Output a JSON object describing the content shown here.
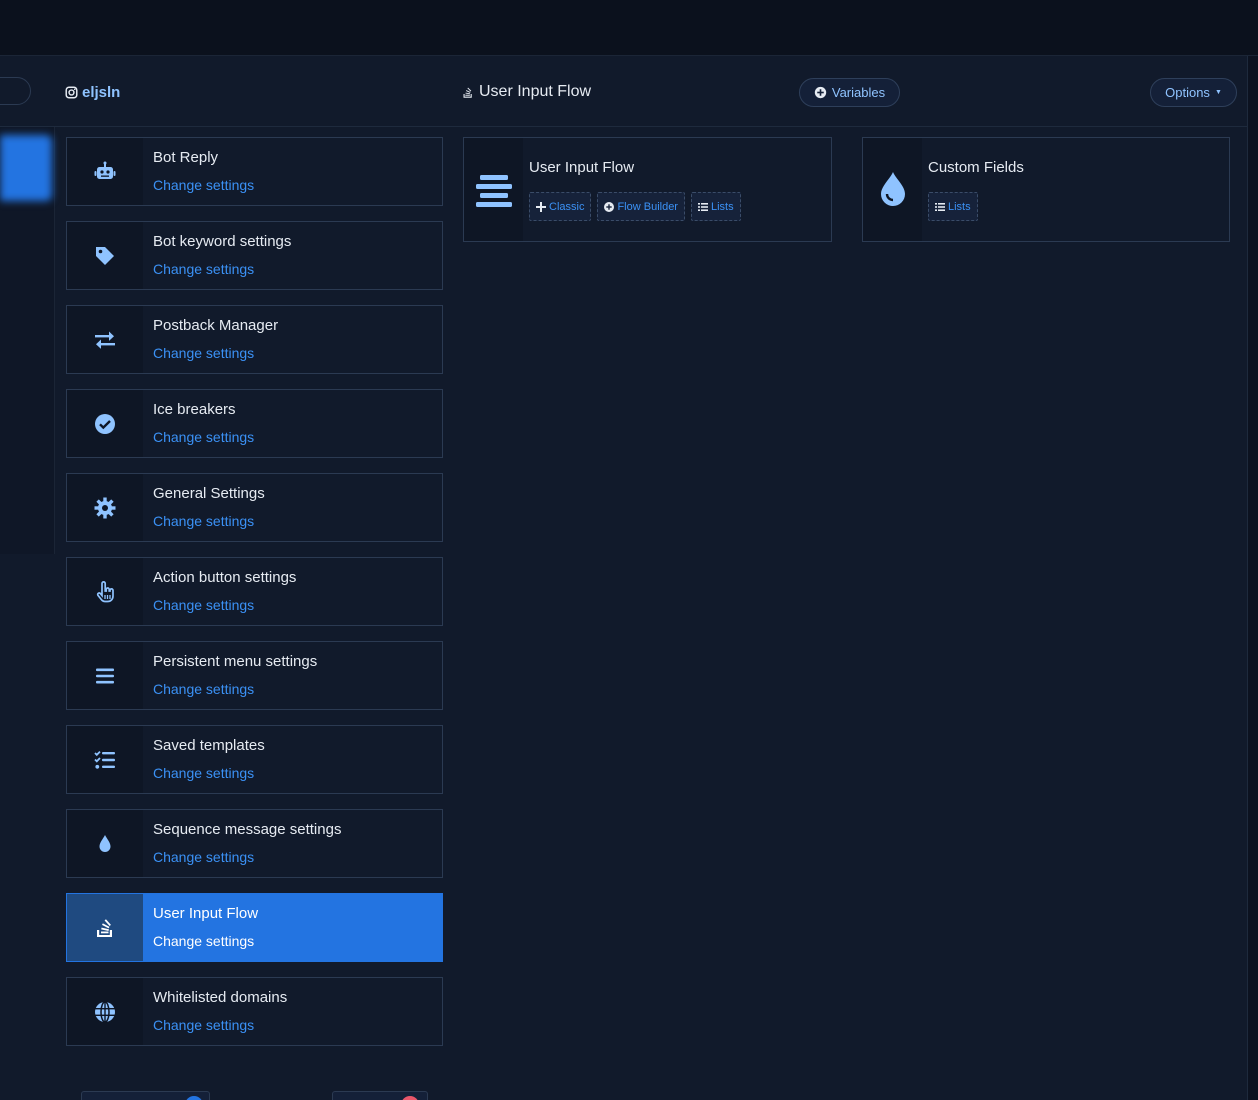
{
  "header": {
    "account_name": "eljsln",
    "page_title": "User Input Flow",
    "variables_label": "Variables",
    "options_label": "Options"
  },
  "menu": [
    {
      "title": "Bot Reply",
      "link": "Change settings",
      "icon": "robot-icon"
    },
    {
      "title": "Bot keyword settings",
      "link": "Change settings",
      "icon": "tag-icon"
    },
    {
      "title": "Postback Manager",
      "link": "Change settings",
      "icon": "exchange-arrows-icon"
    },
    {
      "title": "Ice breakers",
      "link": "Change settings",
      "icon": "check-circle-icon"
    },
    {
      "title": "General Settings",
      "link": "Change settings",
      "icon": "gear-icon"
    },
    {
      "title": "Action button settings",
      "link": "Change settings",
      "icon": "hand-pointer-icon"
    },
    {
      "title": "Persistent menu settings",
      "link": "Change settings",
      "icon": "bars-icon"
    },
    {
      "title": "Saved templates",
      "link": "Change settings",
      "icon": "tasks-list-icon"
    },
    {
      "title": "Sequence message settings",
      "link": "Change settings",
      "icon": "drop-icon"
    },
    {
      "title": "User Input Flow",
      "link": "Change settings",
      "icon": "stack-overflow-icon",
      "active": true
    },
    {
      "title": "Whitelisted domains",
      "link": "Change settings",
      "icon": "globe-icon"
    }
  ],
  "cards": {
    "user_input_flow": {
      "title": "User Input Flow",
      "icon": "align-center-icon",
      "actions": [
        "Classic",
        "Flow Builder",
        "Lists"
      ]
    },
    "custom_fields": {
      "title": "Custom Fields",
      "icon": "drop-icon",
      "actions": [
        "Lists"
      ]
    }
  },
  "colors": {
    "accent": "#2374e1",
    "link": "#3b91f5",
    "icon": "#8fc3ff",
    "background": "#111a2b"
  }
}
